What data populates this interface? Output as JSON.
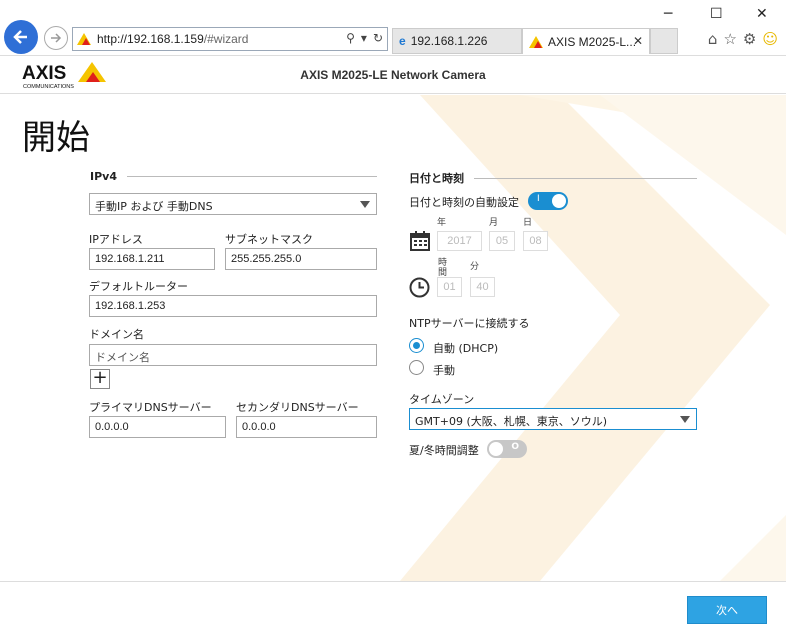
{
  "browser": {
    "url_host": "http://192.168.1.159",
    "url_path": "/#wizard",
    "tabs": [
      {
        "label": "192.168.1.226"
      },
      {
        "label": "AXIS M2025-L..."
      }
    ]
  },
  "app": {
    "logo_text": "AXIS",
    "logo_sub": "COMMUNICATIONS",
    "title": "AXIS M2025-LE Network Camera"
  },
  "page": {
    "title": "開始",
    "next_label": "次へ"
  },
  "ipv4": {
    "heading": "IPv4",
    "mode_value": "手動IP および 手動DNS",
    "ip_label": "IPアドレス",
    "ip_value": "192.168.1.211",
    "subnet_label": "サブネットマスク",
    "subnet_value": "255.255.255.0",
    "router_label": "デフォルトルーター",
    "router_value": "192.168.1.253",
    "domain_label": "ドメイン名",
    "domain_placeholder": "ドメイン名",
    "add_label": "+",
    "dns1_label": "プライマリDNSサーバー",
    "dns1_value": "0.0.0.0",
    "dns2_label": "セカンダリDNSサーバー",
    "dns2_value": "0.0.0.0"
  },
  "datetime": {
    "heading": "日付と時刻",
    "auto_label": "日付と時刻の自動設定",
    "auto_on": true,
    "toggle_on_mark": "I",
    "year_label": "年",
    "month_label": "月",
    "day_label": "日",
    "year": "2017",
    "month": "05",
    "day": "08",
    "hour_label": "時間",
    "minute_label": "分",
    "hour": "01",
    "minute": "40",
    "ntp_label": "NTPサーバーに接続する",
    "ntp_options": [
      "自動 (DHCP)",
      "手動"
    ],
    "ntp_selected": 0,
    "tz_label": "タイムゾーン",
    "tz_value": "GMT+09 (大阪、札幌、東京、ソウル)",
    "dst_label": "夏/冬時間調整",
    "dst_on": false,
    "toggle_off_mark": "O"
  },
  "colors": {
    "accent": "#1a8ed1",
    "button": "#2ea3e3",
    "logo_yellow": "#f5c400",
    "deco": "#fdf3e1"
  }
}
